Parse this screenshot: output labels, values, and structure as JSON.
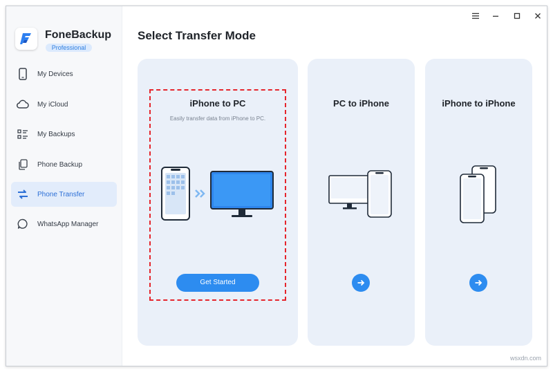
{
  "app": {
    "name": "FoneBackup",
    "edition": "Professional"
  },
  "sidebar": {
    "items": [
      {
        "label": "My Devices",
        "icon": "phone-icon"
      },
      {
        "label": "My iCloud",
        "icon": "cloud-icon"
      },
      {
        "label": "My Backups",
        "icon": "backups-list-icon"
      },
      {
        "label": "Phone Backup",
        "icon": "phone-backup-icon"
      },
      {
        "label": "Phone Transfer",
        "icon": "transfer-arrows-icon",
        "active": true
      },
      {
        "label": "WhatsApp Manager",
        "icon": "chat-bubble-icon"
      }
    ]
  },
  "window_controls": {
    "menu": "menu-icon",
    "minimize": "minimize-icon",
    "maximize": "maximize-icon",
    "close": "close-icon"
  },
  "main": {
    "title": "Select Transfer Mode",
    "modes": [
      {
        "title": "iPhone to PC",
        "description": "Easily transfer data from iPhone to PC.",
        "button": "Get Started",
        "selected": true
      },
      {
        "title": "PC to iPhone"
      },
      {
        "title": "iPhone to iPhone"
      }
    ]
  },
  "watermark": "wsxdn.com",
  "colors": {
    "accent": "#2d8cf0",
    "selection_border": "#e5252c",
    "card_bg": "#eaf0f9",
    "sidebar_active_bg": "#e2ecfb"
  }
}
